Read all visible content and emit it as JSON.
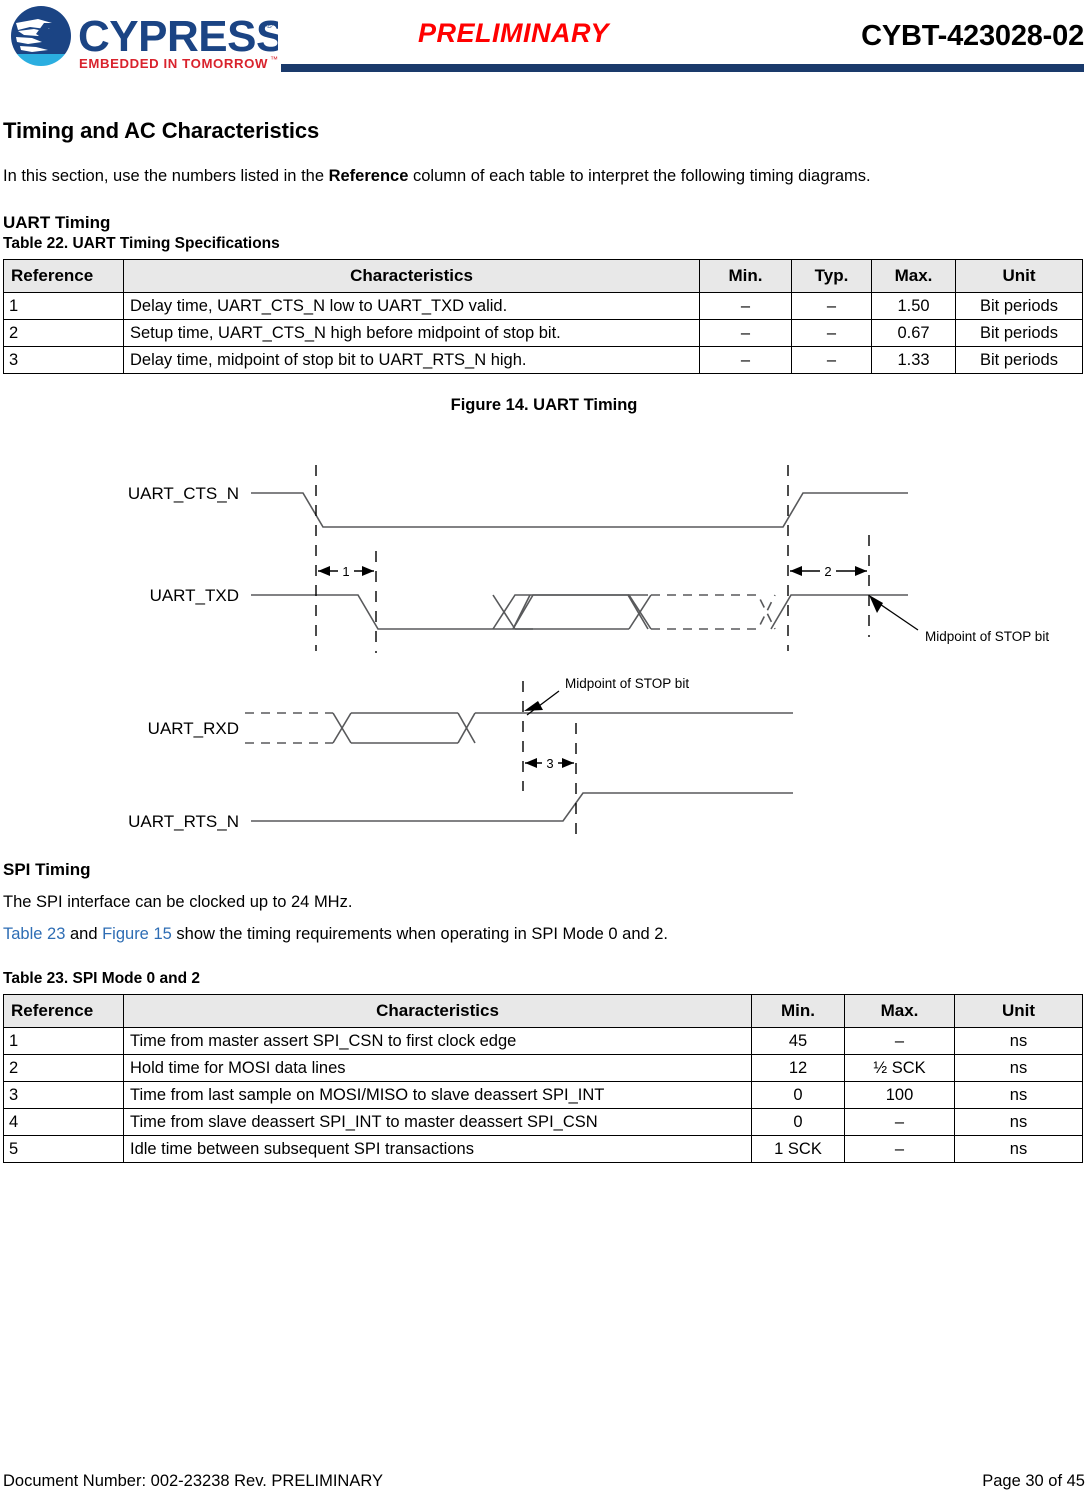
{
  "header": {
    "logo_word": "CYPRESS",
    "logo_tagline": "EMBEDDED IN TOMORROW",
    "logo_tm": "™",
    "status_stamp": "PRELIMINARY",
    "part_number": "CYBT-423028-02",
    "rule_color": "#1A3A6B",
    "stamp_color": "#FF0000"
  },
  "main": {
    "section_title": "Timing and AC Characteristics",
    "intro_before": "In this section, use the numbers listed in the ",
    "intro_bold": "Reference",
    "intro_after": " column of each table to interpret the following timing diagrams.",
    "uart": {
      "subhead": "UART Timing",
      "table_caption": "Table 22.  UART Timing Specifications",
      "columns": [
        "Reference",
        "Characteristics",
        "Min.",
        "Typ.",
        "Max.",
        "Unit"
      ],
      "rows": [
        {
          "ref": "1",
          "desc": "Delay time, UART_CTS_N low to UART_TXD valid.",
          "min": "–",
          "typ": "–",
          "max": "1.50",
          "unit": "Bit periods"
        },
        {
          "ref": "2",
          "desc": "Setup time, UART_CTS_N high before midpoint of stop bit.",
          "min": "–",
          "typ": "–",
          "max": "0.67",
          "unit": "Bit periods"
        },
        {
          "ref": "3",
          "desc": "Delay time, midpoint of stop bit to UART_RTS_N high.",
          "min": "–",
          "typ": "–",
          "max": "1.33",
          "unit": "Bit periods"
        }
      ],
      "figure_caption": "Figure 14.  UART Timing",
      "figure": {
        "signals": [
          "UART_CTS_N",
          "UART_TXD",
          "UART_RXD",
          "UART_RTS_N"
        ],
        "markers": [
          "1",
          "2",
          "3"
        ],
        "annotations": [
          "Midpoint of STOP bit",
          "Midpoint of STOP bit"
        ]
      }
    },
    "spi": {
      "subhead": "SPI Timing",
      "text1": "The SPI interface can be clocked up to 24 MHz.",
      "text2_link1": "Table 23",
      "text2_mid": " and ",
      "text2_link2": "Figure 15",
      "text2_end": " show the timing requirements when operating in SPI Mode 0 and 2.",
      "table_caption": "Table 23.  SPI Mode 0 and 2",
      "columns": [
        "Reference",
        "Characteristics",
        "Min.",
        "Max.",
        "Unit"
      ],
      "rows": [
        {
          "ref": "1",
          "desc": "Time from master assert SPI_CSN to first clock edge",
          "min": "45",
          "max": "–",
          "unit": "ns"
        },
        {
          "ref": "2",
          "desc": "Hold time for MOSI data lines",
          "min": "12",
          "max": "½ SCK",
          "unit": "ns"
        },
        {
          "ref": "3",
          "desc": "Time from last sample on MOSI/MISO to slave deassert SPI_INT",
          "min": "0",
          "max": "100",
          "unit": "ns"
        },
        {
          "ref": "4",
          "desc": "Time from slave deassert SPI_INT to master deassert SPI_CSN",
          "min": "0",
          "max": "–",
          "unit": "ns"
        },
        {
          "ref": "5",
          "desc": "Idle time between subsequent SPI transactions",
          "min": "1 SCK",
          "max": "–",
          "unit": "ns"
        }
      ]
    }
  },
  "footer": {
    "document_number": "Document Number: 002-23238 Rev. PRELIMINARY",
    "page_label": "Page 30 of 45"
  }
}
